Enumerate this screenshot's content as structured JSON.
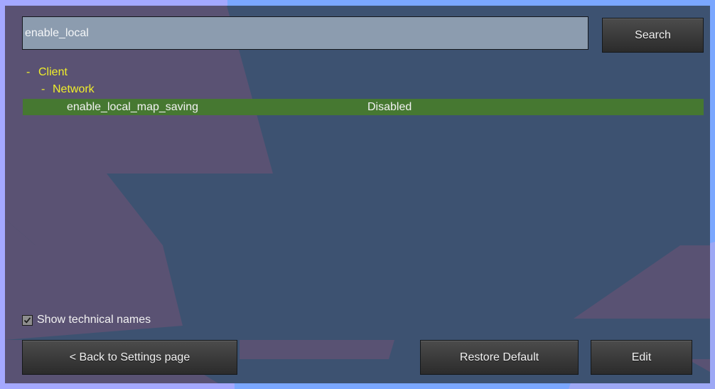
{
  "search": {
    "value": "enable_local",
    "button_label": "Search"
  },
  "tree": {
    "client": {
      "toggle": "-",
      "label": "Client"
    },
    "network": {
      "toggle": "-",
      "label": "Network"
    },
    "setting": {
      "name": "enable_local_map_saving",
      "value": "Disabled"
    }
  },
  "options": {
    "show_technical_names_label": "Show technical names",
    "show_technical_names_checked": true
  },
  "footer": {
    "back_label": "< Back to Settings page",
    "restore_label": "Restore Default",
    "edit_label": "Edit"
  },
  "colors": {
    "panel_bg": "#3d5271",
    "group_text": "#f0ef2a",
    "selected_row": "#467831",
    "outer_bg": "#7aa7ff"
  }
}
